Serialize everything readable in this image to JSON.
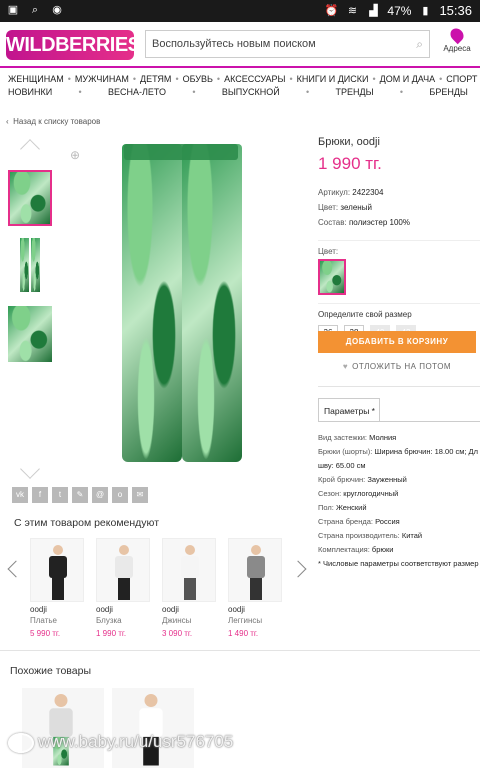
{
  "status_bar": {
    "icons_left": [
      "image-icon",
      "search-icon",
      "chat-icon"
    ],
    "icons_right": [
      "alarm-icon",
      "wifi-icon",
      "signal-icon"
    ],
    "battery": "47%",
    "time": "15:36"
  },
  "header": {
    "logo": "WILDBERRIES",
    "search_placeholder": "Воспользуйтесь новым поиском",
    "address_label": "Адреса"
  },
  "nav": {
    "row1": [
      "ЖЕНЩИНАМ",
      "МУЖЧИНАМ",
      "ДЕТЯМ",
      "ОБУВЬ",
      "АКСЕССУАРЫ",
      "КНИГИ И ДИСКИ",
      "ДОМ И ДАЧА",
      "СПОРТ",
      "И"
    ],
    "row2": [
      "НОВИНКИ",
      "ВЕСНА-ЛЕТО",
      "ВЫПУСКНОЙ",
      "ТРЕНДЫ",
      "БРЕНДЫ"
    ]
  },
  "back_link": "Назад к списку товаров",
  "product": {
    "title": "Брюки, oodji",
    "price": "1 990 тг.",
    "article_label": "Артикул:",
    "article": "2422304",
    "color_label": "Цвет:",
    "color": "зеленый",
    "composition_label": "Состав:",
    "composition": "полиэстер 100%",
    "color_pick_label": "Цвет:",
    "size_label": "Определите свой размер",
    "sizes": [
      {
        "label": "36",
        "available": true
      },
      {
        "label": "38",
        "available": true
      },
      {
        "label": "40",
        "available": false
      },
      {
        "label": "42",
        "available": false
      }
    ],
    "add_to_cart": "ДОБАВИТЬ В КОРЗИНУ",
    "postpone": "ОТЛОЖИТЬ НА ПОТОМ"
  },
  "params_tab": "Параметры *",
  "params": [
    {
      "label": "Вид застежки:",
      "value": "Молния"
    },
    {
      "label": "Брюки (шорты):",
      "value": "Ширина брючин: 18.00 см; Дл"
    },
    {
      "label": "",
      "value": "шву: 65.00 см"
    },
    {
      "label": "Крой брючин:",
      "value": "Зауженный"
    },
    {
      "label": "Сезон:",
      "value": "круглогодичный"
    },
    {
      "label": "Пол:",
      "value": "Женский"
    },
    {
      "label": "Страна бренда:",
      "value": "Россия"
    },
    {
      "label": "Страна производитель:",
      "value": "Китай"
    },
    {
      "label": "Комплектация:",
      "value": "брюки"
    },
    {
      "label": "",
      "value": "* Числовые параметры соответствуют размер"
    }
  ],
  "social_icons": [
    "vk-icon",
    "facebook-icon",
    "twitter-icon",
    "link-icon",
    "mail-icon",
    "odnoklassniki-icon",
    "email-icon"
  ],
  "social_glyphs": [
    "vk",
    "f",
    "t",
    "✎",
    "@",
    "о",
    "✉"
  ],
  "recommend_title": "С этим товаром рекомендуют",
  "recommended": [
    {
      "brand": "oodji",
      "name": "Платье",
      "price": "5 990 тг.",
      "top_color": "#222222",
      "bottom_color": "#222222"
    },
    {
      "brand": "oodji",
      "name": "Блузка",
      "price": "1 990 тг.",
      "top_color": "#e9e9e9",
      "bottom_color": "#222222"
    },
    {
      "brand": "oodji",
      "name": "Джинсы",
      "price": "3 090 тг.",
      "top_color": "#f5f5f5",
      "bottom_color": "#555555"
    },
    {
      "brand": "oodji",
      "name": "Леггинсы",
      "price": "1 490 тг.",
      "top_color": "#8a8a8a",
      "bottom_color": "#333333"
    }
  ],
  "similar_title": "Похожие товары",
  "watermark": "www.baby.ru/u/usr576705",
  "colors": {
    "brand": "#cb11ab",
    "price": "#e52f8a",
    "cart": "#f39233"
  }
}
